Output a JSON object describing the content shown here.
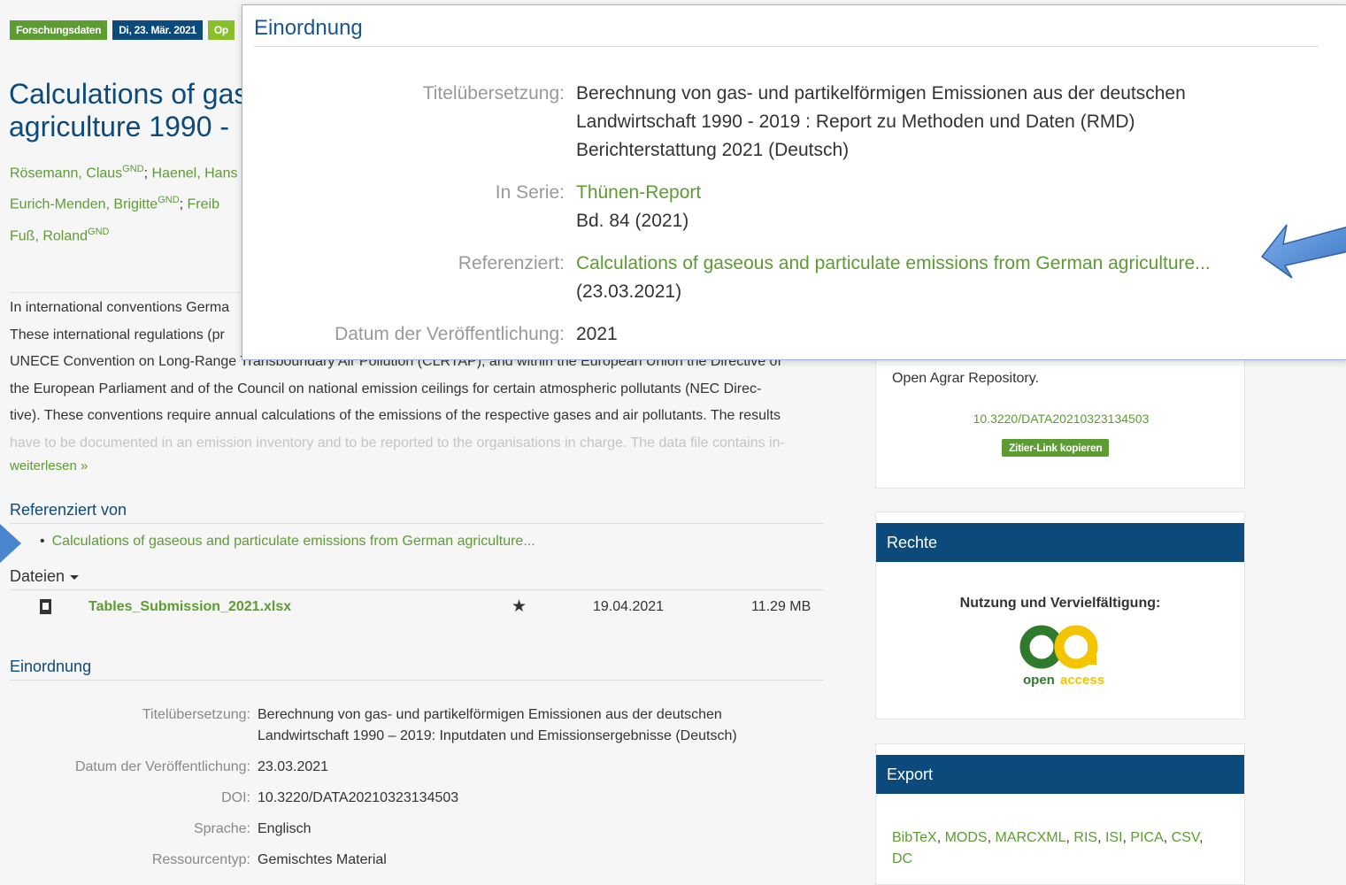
{
  "badges": [
    "Forschungsdaten",
    "Di, 23. Mär. 2021",
    "Op"
  ],
  "title_lines": [
    "Calculations of gas",
    "agriculture 1990 -"
  ],
  "authors": [
    {
      "name": "Rösemann, Claus",
      "sup": "GND",
      "sep": "; "
    },
    {
      "name": "Haenel, Hans",
      "sup": "",
      "sep": ""
    },
    {
      "name": "Eurich-Menden, Brigitte",
      "sup": "GND",
      "sep": "; "
    },
    {
      "name": "Freib",
      "sup": "",
      "sep": ""
    },
    {
      "name": "Fuß, Roland",
      "sup": "GND",
      "sep": ""
    }
  ],
  "abstract": [
    "In international conventions Germa",
    "These international regulations (pr",
    "UNECE Convention on Long-Range Transboundary Air Pollution (CLRTAP), and within the European Union the Directive of",
    "the European Parliament and of the Council on national emission ceilings for certain atmospheric pollutants (NEC Direc-",
    "tive). These conventions require annual calculations of the emissions of the respective gases and air pollutants. The results",
    "have to be documented in an emission inventory and to be reported to the organisations in charge. The data file contains in-"
  ],
  "readmore": "weiterlesen »",
  "referenced_by": {
    "heading": "Referenziert von",
    "items": [
      "Calculations of gaseous and particulate emissions from German agriculture..."
    ]
  },
  "files": {
    "heading": "Dateien",
    "rows": [
      {
        "name": "Tables_Submission_2021.xlsx",
        "date": "19.04.2021",
        "size": "11.29 MB"
      }
    ]
  },
  "einordnung": {
    "heading": "Einordnung",
    "rows": [
      {
        "label": "Titelübersetzung:",
        "value": "Berechnung von gas- und partikelförmigen Emissionen aus der deutschen",
        "value2": "Landwirtschaft 1990 – 2019: Inputdaten und Emissionsergebnisse (Deutsch)"
      },
      {
        "label": "Datum der Veröffentlichung:",
        "value": "23.03.2021"
      },
      {
        "label": "DOI:",
        "value": "10.3220/DATA20210323134503"
      },
      {
        "label": "Sprache:",
        "value": "Englisch"
      },
      {
        "label": "Ressourcentyp:",
        "value": "Gemischtes Material"
      }
    ]
  },
  "sidebar": {
    "repo_text": "Open Agrar Repository.",
    "doi": "10.3220/DATA20210323134503",
    "cite_button": "Zitier-Link kopieren",
    "rights_heading": "Rechte",
    "rights_text": "Nutzung und Vervielfältigung:",
    "oa_word1": "open",
    "oa_word2": "access",
    "export_heading": "Export",
    "export_links": [
      "BibTeX",
      "MODS",
      "MARCXML",
      "RIS",
      "ISI",
      "PICA",
      "CSV",
      "DC"
    ]
  },
  "popup": {
    "title": "Einordnung",
    "translation_label": "Titelübersetzung:",
    "translation_lines": [
      "Berechnung von gas- und partikelförmigen Emissionen aus der deutschen",
      "Landwirtschaft 1990 - 2019 : Report zu Methoden und Daten (RMD)",
      "Berichterstattung 2021 (Deutsch)"
    ],
    "series_label": "In Serie:",
    "series_link": "Thünen-Report",
    "series_vol": "Bd. 84 (2021)",
    "ref_label": "Referenziert:",
    "ref_link": "Calculations of gaseous and particulate emissions from German agriculture...",
    "ref_date": "(23.03.2021)",
    "date_label": "Datum der Veröffentlichung:",
    "date_value": "2021"
  },
  "colors": {
    "brand_blue": "#0b4a7b",
    "link_green": "#5c9c32",
    "arrow_blue": "#4a86d0"
  }
}
